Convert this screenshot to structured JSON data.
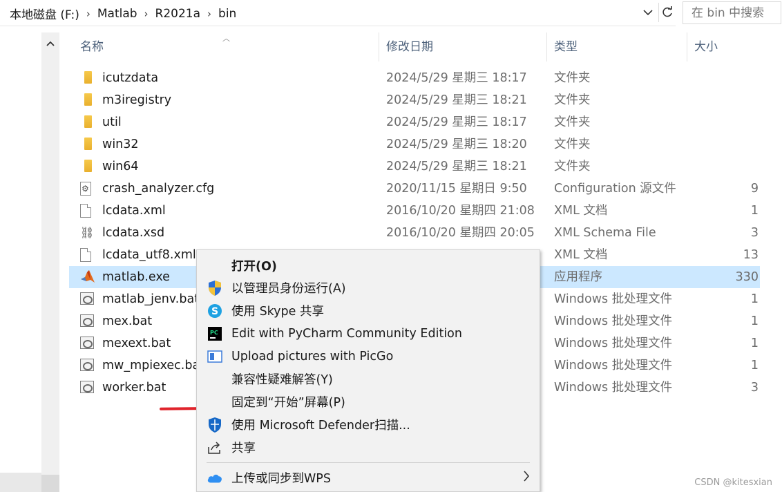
{
  "address_bar": {
    "crumbs": [
      "本地磁盘 (F:)",
      "Matlab",
      "R2021a",
      "bin"
    ],
    "separator": "›",
    "search_placeholder": "在 bin 中搜索"
  },
  "columns": {
    "name": "名称",
    "date": "修改日期",
    "type": "类型",
    "size": "大小"
  },
  "files": [
    {
      "name": "icutzdata",
      "date": "2024/5/29 星期三 18:17",
      "type": "文件夹",
      "size": "",
      "icon": "folder"
    },
    {
      "name": "m3iregistry",
      "date": "2024/5/29 星期三 18:21",
      "type": "文件夹",
      "size": "",
      "icon": "folder"
    },
    {
      "name": "util",
      "date": "2024/5/29 星期三 18:17",
      "type": "文件夹",
      "size": "",
      "icon": "folder"
    },
    {
      "name": "win32",
      "date": "2024/5/29 星期三 18:20",
      "type": "文件夹",
      "size": "",
      "icon": "folder"
    },
    {
      "name": "win64",
      "date": "2024/5/29 星期三 18:21",
      "type": "文件夹",
      "size": "",
      "icon": "folder"
    },
    {
      "name": "crash_analyzer.cfg",
      "date": "2020/11/15 星期日 9:50",
      "type": "Configuration 源文件",
      "size": "9",
      "icon": "config"
    },
    {
      "name": "lcdata.xml",
      "date": "2016/10/20 星期四 21:08",
      "type": "XML 文档",
      "size": "1",
      "icon": "document"
    },
    {
      "name": "lcdata.xsd",
      "date": "2016/10/20 星期四 20:05",
      "type": "XML Schema File",
      "size": "3",
      "icon": "schema"
    },
    {
      "name": "lcdata_utf8.xml",
      "date": "",
      "type": "XML 文档",
      "size": "13",
      "icon": "document"
    },
    {
      "name": "matlab.exe",
      "date": "",
      "type": "应用程序",
      "size": "330",
      "icon": "matlab",
      "selected": true
    },
    {
      "name": "matlab_jenv.bat",
      "date": "",
      "type": "Windows 批处理文件",
      "size": "1",
      "icon": "batch"
    },
    {
      "name": "mex.bat",
      "date": "",
      "type": "Windows 批处理文件",
      "size": "1",
      "icon": "batch"
    },
    {
      "name": "mexext.bat",
      "date": "",
      "type": "Windows 批处理文件",
      "size": "1",
      "icon": "batch"
    },
    {
      "name": "mw_mpiexec.bat",
      "date": "",
      "type": "Windows 批处理文件",
      "size": "1",
      "icon": "batch"
    },
    {
      "name": "worker.bat",
      "date": "",
      "type": "Windows 批处理文件",
      "size": "3",
      "icon": "batch"
    }
  ],
  "context_menu": {
    "items": [
      {
        "label": "打开(O)",
        "icon": "",
        "bold": true
      },
      {
        "label": "以管理员身份运行(A)",
        "icon": "uac-shield-icon"
      },
      {
        "label": "使用 Skype 共享",
        "icon": "skype-icon"
      },
      {
        "label": "Edit with PyCharm Community Edition",
        "icon": "pycharm-icon"
      },
      {
        "label": "Upload pictures with PicGo",
        "icon": "picgo-icon"
      },
      {
        "label": "兼容性疑难解答(Y)",
        "icon": ""
      },
      {
        "label": "固定到“开始”屏幕(P)",
        "icon": ""
      },
      {
        "label": "使用 Microsoft Defender扫描...",
        "icon": "defender-icon"
      },
      {
        "label": "共享",
        "icon": "share-icon"
      },
      {
        "label": "上传或同步到WPS",
        "icon": "wps-cloud-icon",
        "submenu": true
      }
    ]
  },
  "annotation": {
    "highlight_color": "#e0242c"
  },
  "watermark": "CSDN @kitesxian",
  "colors": {
    "selection": "#cce8ff",
    "header_text": "#4c607a",
    "folder": "#f6c94b"
  }
}
